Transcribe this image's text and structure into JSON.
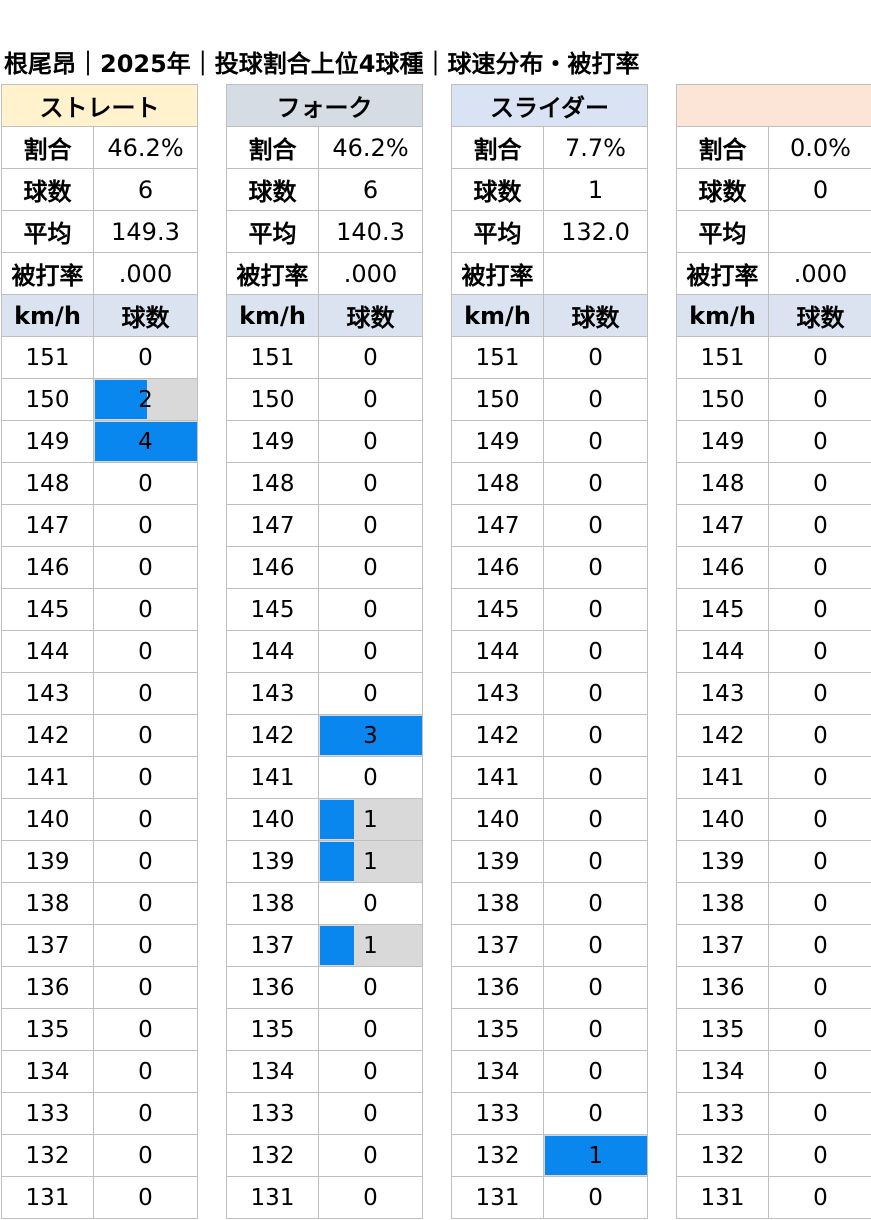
{
  "title": "根尾昂｜2025年｜投球割合上位4球種｜球速分布・被打率",
  "labels": {
    "ratio": "割合",
    "count": "球数",
    "avg": "平均",
    "avg_against": "被打率",
    "speed_unit": "km/h",
    "pitch_count": "球数"
  },
  "colors": {
    "bar": "#0a87ee",
    "bar_track": "#d9d9d9",
    "header": "#dbe2f0"
  },
  "chart_data": {
    "type": "table",
    "speeds": [
      151,
      150,
      149,
      148,
      147,
      146,
      145,
      144,
      143,
      142,
      141,
      140,
      139,
      138,
      137,
      136,
      135,
      134,
      133,
      132,
      131
    ],
    "pitches": [
      {
        "name": "ストレート",
        "color": "#fff2cc",
        "ratio": "46.2%",
        "count": "6",
        "avg": "149.3",
        "avg_against": ".000",
        "dist": [
          0,
          2,
          4,
          0,
          0,
          0,
          0,
          0,
          0,
          0,
          0,
          0,
          0,
          0,
          0,
          0,
          0,
          0,
          0,
          0,
          0
        ]
      },
      {
        "name": "フォーク",
        "color": "#d6dce4",
        "ratio": "46.2%",
        "count": "6",
        "avg": "140.3",
        "avg_against": ".000",
        "dist": [
          0,
          0,
          0,
          0,
          0,
          0,
          0,
          0,
          0,
          3,
          0,
          1,
          1,
          0,
          1,
          0,
          0,
          0,
          0,
          0,
          0
        ]
      },
      {
        "name": "スライダー",
        "color": "#dae3f3",
        "ratio": "7.7%",
        "count": "1",
        "avg": "132.0",
        "avg_against": "",
        "dist": [
          0,
          0,
          0,
          0,
          0,
          0,
          0,
          0,
          0,
          0,
          0,
          0,
          0,
          0,
          0,
          0,
          0,
          0,
          0,
          1,
          0
        ]
      },
      {
        "name": "",
        "color": "#fce4d6",
        "ratio": "0.0%",
        "count": "0",
        "avg": "",
        "avg_against": ".000",
        "dist": [
          0,
          0,
          0,
          0,
          0,
          0,
          0,
          0,
          0,
          0,
          0,
          0,
          0,
          0,
          0,
          0,
          0,
          0,
          0,
          0,
          0
        ]
      }
    ]
  }
}
